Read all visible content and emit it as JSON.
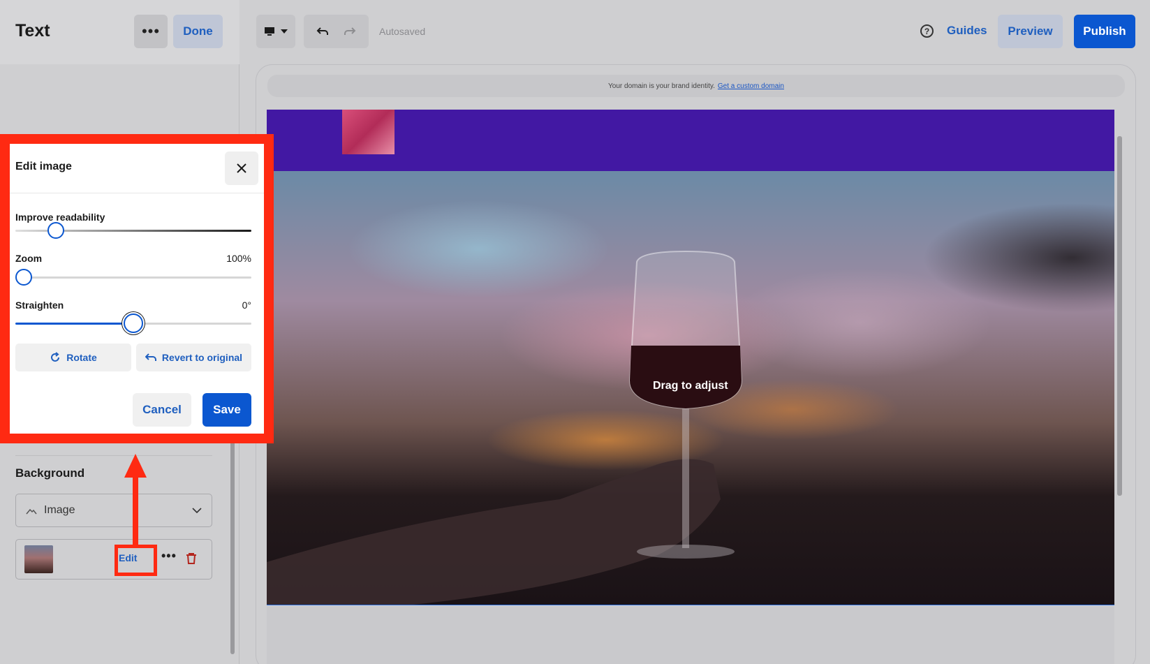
{
  "sidebar_panel": {
    "title": "Text",
    "more_label": "•••",
    "done_label": "Done"
  },
  "toolbar": {
    "autosaved": "Autosaved",
    "help_glyph": "?",
    "guides": "Guides",
    "preview": "Preview",
    "publish": "Publish"
  },
  "canvas": {
    "domain_text": "Your domain is your brand identity.",
    "domain_link": "Get a custom domain",
    "drag_hint": "Drag to adjust"
  },
  "edit_image": {
    "title": "Edit image",
    "improve_readability": {
      "label": "Improve readability",
      "level": 0.17
    },
    "zoom": {
      "label": "Zoom",
      "value": "100%",
      "level": 0.0
    },
    "straighten": {
      "label": "Straighten",
      "value": "0°",
      "level": 0.5
    },
    "rotate_label": "Rotate",
    "revert_label": "Revert to original",
    "cancel_label": "Cancel",
    "save_label": "Save"
  },
  "background": {
    "heading": "Background",
    "type_selected": "Image",
    "edit_label": "Edit",
    "more_label": "•••"
  },
  "colors": {
    "primary": "#0b57d0",
    "header_purple": "#4218a3",
    "annotation_red": "#ff2a12"
  },
  "icons": [
    "more-icon",
    "desktop-icon",
    "caret-down-icon",
    "undo-icon",
    "redo-icon",
    "help-icon",
    "close-icon",
    "rotate-icon",
    "revert-icon",
    "image-type-icon",
    "chevron-down-icon",
    "trash-icon",
    "arrow-up-icon"
  ]
}
